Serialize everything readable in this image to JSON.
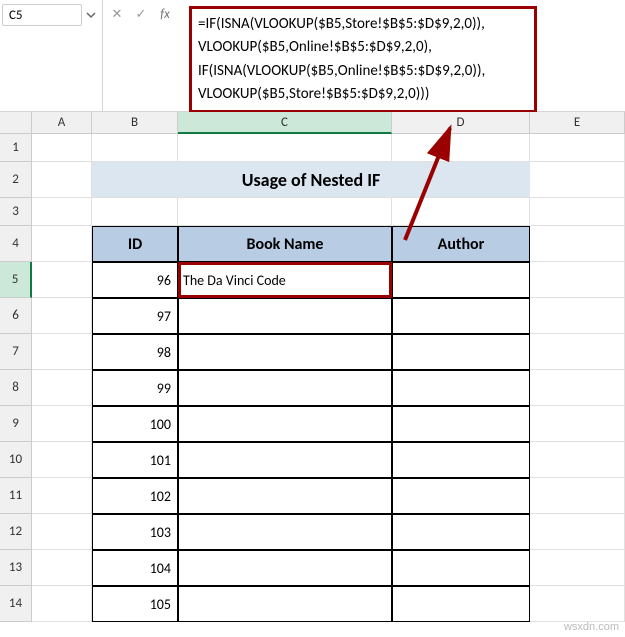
{
  "formula_bar": {
    "name_box": "C5",
    "cancel_icon": "✕",
    "confirm_icon": "✓",
    "fx_label": "fx",
    "formula": "=IF(ISNA(VLOOKUP($B5,Store!$B$5:$D$9,2,0)),\nVLOOKUP($B5,Online!$B$5:$D$9,2,0),\nIF(ISNA(VLOOKUP($B5,Online!$B$5:$D$9,2,0)),\nVLOOKUP($B5,Store!$B$5:$D$9,2,0)))"
  },
  "columns": [
    "A",
    "B",
    "C",
    "D",
    "E"
  ],
  "active_column": "C",
  "rows": [
    1,
    2,
    3,
    4,
    5,
    6,
    7,
    8,
    9,
    10,
    11,
    12,
    13,
    14
  ],
  "active_row": 5,
  "title": "Usage of Nested IF",
  "table": {
    "headers": {
      "id": "ID",
      "book": "Book Name",
      "author": "Author"
    },
    "rows": [
      {
        "id": 96,
        "book": "The Da Vinci Code",
        "author": ""
      },
      {
        "id": 97,
        "book": "",
        "author": ""
      },
      {
        "id": 98,
        "book": "",
        "author": ""
      },
      {
        "id": 99,
        "book": "",
        "author": ""
      },
      {
        "id": 100,
        "book": "",
        "author": ""
      },
      {
        "id": 101,
        "book": "",
        "author": ""
      },
      {
        "id": 102,
        "book": "",
        "author": ""
      },
      {
        "id": 103,
        "book": "",
        "author": ""
      },
      {
        "id": 104,
        "book": "",
        "author": ""
      },
      {
        "id": 105,
        "book": "",
        "author": ""
      }
    ]
  },
  "row_heights": {
    "default": 36,
    "r1": 28,
    "r3": 28
  },
  "watermark": "wsxdn.com"
}
